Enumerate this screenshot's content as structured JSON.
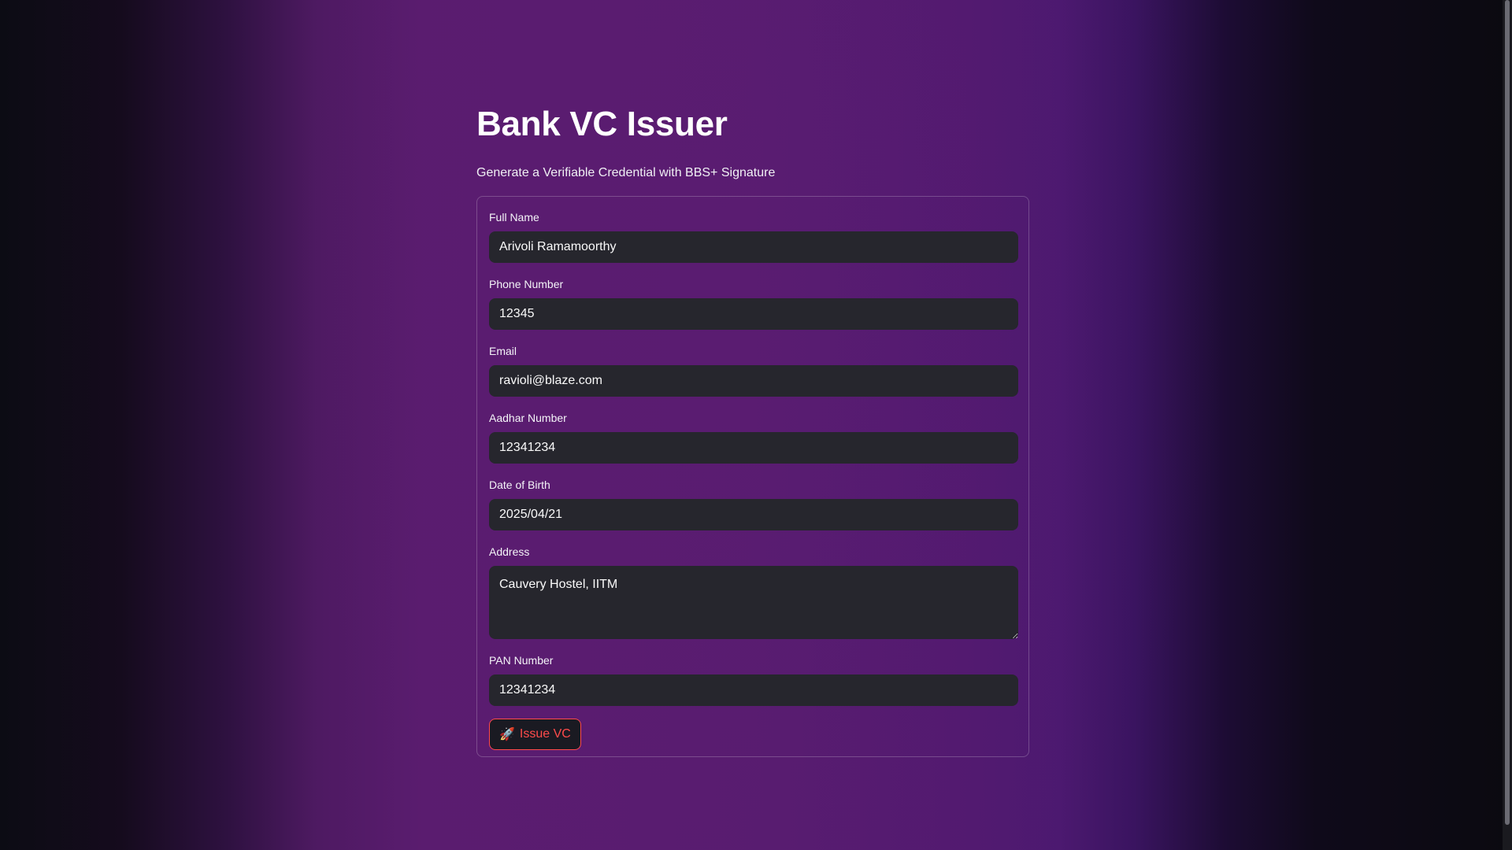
{
  "page": {
    "title": "Bank VC Issuer",
    "subtitle": "Generate a Verifiable Credential with BBS+ Signature"
  },
  "form": {
    "full_name": {
      "label": "Full Name",
      "value": "Arivoli Ramamoorthy"
    },
    "phone": {
      "label": "Phone Number",
      "value": "12345"
    },
    "email": {
      "label": "Email",
      "value": "ravioli@blaze.com"
    },
    "aadhar": {
      "label": "Aadhar Number",
      "value": "12341234"
    },
    "dob": {
      "label": "Date of Birth",
      "value": "2025/04/21"
    },
    "address": {
      "label": "Address",
      "value": "Cauvery Hostel, IITM"
    },
    "pan": {
      "label": "PAN Number",
      "value": "12341234"
    },
    "submit": {
      "icon": "rocket-icon",
      "icon_glyph": "🚀",
      "label": "Issue VC"
    }
  },
  "colors": {
    "accent": "#ff4b4b",
    "input_bg": "#26262d",
    "bg_purple": "#581c70"
  }
}
